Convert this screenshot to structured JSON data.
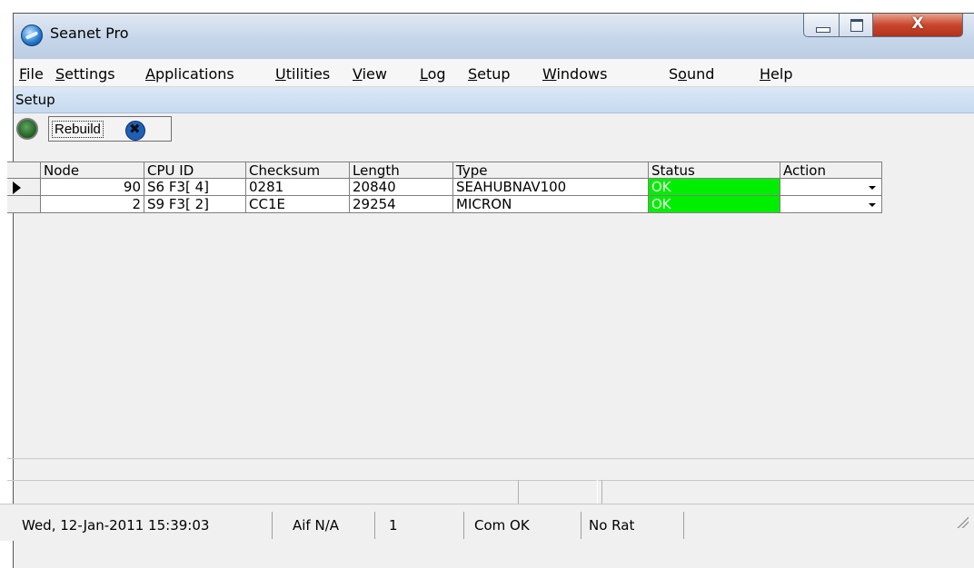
{
  "window": {
    "title": "Seanet Pro",
    "close_glyph": "X"
  },
  "menu": {
    "items": [
      {
        "pre": "",
        "key": "F",
        "post": "ile"
      },
      {
        "pre": "",
        "key": "S",
        "post": "ettings"
      },
      {
        "pre": "",
        "key": "A",
        "post": "pplications"
      },
      {
        "pre": "",
        "key": "U",
        "post": "tilities"
      },
      {
        "pre": "",
        "key": "V",
        "post": "iew"
      },
      {
        "pre": "",
        "key": "L",
        "post": "og"
      },
      {
        "pre": "",
        "key": "S",
        "post": "etup"
      },
      {
        "pre": "",
        "key": "W",
        "post": "indows"
      },
      {
        "pre": "S",
        "key": "o",
        "post": "und"
      },
      {
        "pre": "",
        "key": "H",
        "post": "elp"
      }
    ]
  },
  "setup_bar": {
    "label": "Setup"
  },
  "toolbar": {
    "rebuild_label": "Rebuild",
    "led_color": "#2e7d2e"
  },
  "table": {
    "columns": [
      "Node",
      "CPU ID",
      "Checksum",
      "Length",
      "Type",
      "Status",
      "Action"
    ],
    "rows": [
      {
        "selected": true,
        "node": "90",
        "cpu_id": "S6 F3[ 4]",
        "checksum": "0281",
        "length": "20840",
        "type": "SEAHUBNAV100",
        "status": "OK",
        "action": ""
      },
      {
        "selected": false,
        "node": "2",
        "cpu_id": "S9 F3[ 2]",
        "checksum": "CC1E",
        "length": "29254",
        "type": "MICRON",
        "status": "OK",
        "action": ""
      }
    ],
    "status_ok_color": "#00ee00"
  },
  "statusbar": {
    "datetime": "Wed, 12-Jan-2011 15:39:03",
    "aif": "Aif N/A",
    "count": "1",
    "com": "Com OK",
    "rat": "No Rat"
  }
}
